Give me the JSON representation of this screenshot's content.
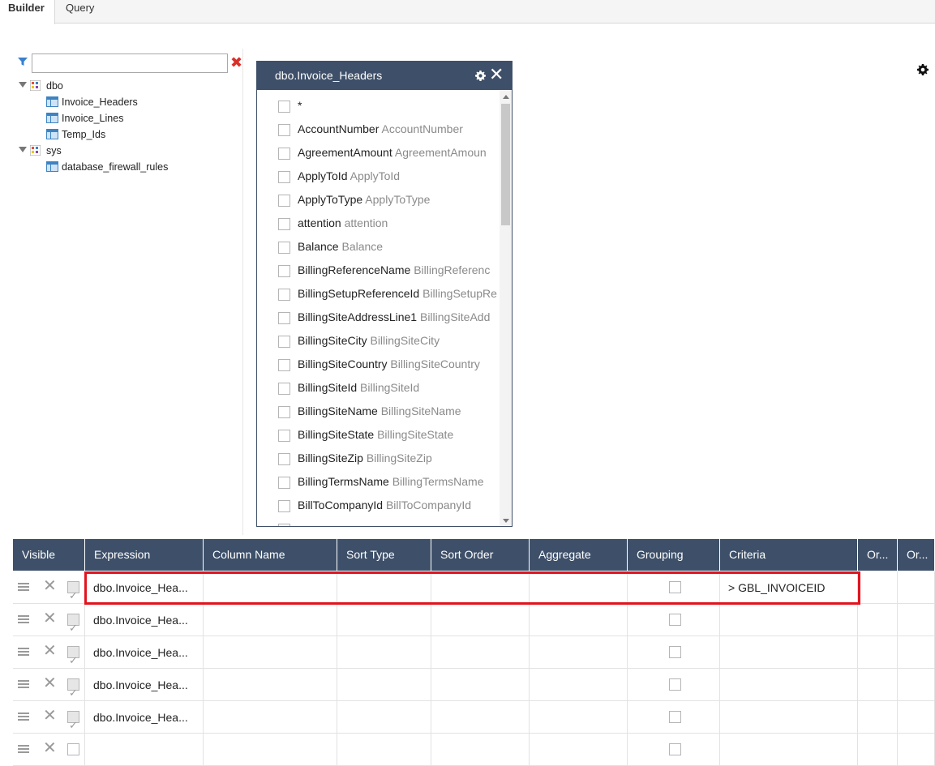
{
  "tabs": [
    {
      "label": "Builder",
      "active": true
    },
    {
      "label": "Query",
      "active": false
    }
  ],
  "tree": {
    "filter_value": "",
    "schemas": [
      {
        "name": "dbo",
        "tables": [
          "Invoice_Headers",
          "Invoice_Lines",
          "Temp_Ids"
        ]
      },
      {
        "name": "sys",
        "tables": [
          "database_firewall_rules"
        ]
      }
    ]
  },
  "entity": {
    "title": "dbo.Invoice_Headers",
    "fields": [
      {
        "name": "*",
        "alias": ""
      },
      {
        "name": "AccountNumber",
        "alias": "AccountNumber"
      },
      {
        "name": "AgreementAmount",
        "alias": "AgreementAmoun"
      },
      {
        "name": "ApplyToId",
        "alias": "ApplyToId"
      },
      {
        "name": "ApplyToType",
        "alias": "ApplyToType"
      },
      {
        "name": "attention",
        "alias": "attention"
      },
      {
        "name": "Balance",
        "alias": "Balance"
      },
      {
        "name": "BillingReferenceName",
        "alias": "BillingReferenc"
      },
      {
        "name": "BillingSetupReferenceId",
        "alias": "BillingSetupRe"
      },
      {
        "name": "BillingSiteAddressLine1",
        "alias": "BillingSiteAdd"
      },
      {
        "name": "BillingSiteCity",
        "alias": "BillingSiteCity"
      },
      {
        "name": "BillingSiteCountry",
        "alias": "BillingSiteCountry"
      },
      {
        "name": "BillingSiteId",
        "alias": "BillingSiteId"
      },
      {
        "name": "BillingSiteName",
        "alias": "BillingSiteName"
      },
      {
        "name": "BillingSiteState",
        "alias": "BillingSiteState"
      },
      {
        "name": "BillingSiteZip",
        "alias": "BillingSiteZip"
      },
      {
        "name": "BillingTermsName",
        "alias": "BillingTermsName"
      },
      {
        "name": "BillToCompanyId",
        "alias": "BillToCompanyId"
      }
    ]
  },
  "grid": {
    "headers": [
      "Visible",
      "Expression",
      "Column Name",
      "Sort Type",
      "Sort Order",
      "Aggregate",
      "Grouping",
      "Criteria",
      "Or...",
      "Or..."
    ],
    "rows": [
      {
        "expression": "dbo.Invoice_Hea...",
        "visible": true,
        "criteria": "> GBL_INVOICEID"
      },
      {
        "expression": "dbo.Invoice_Hea...",
        "visible": true,
        "criteria": ""
      },
      {
        "expression": "dbo.Invoice_Hea...",
        "visible": true,
        "criteria": ""
      },
      {
        "expression": "dbo.Invoice_Hea...",
        "visible": true,
        "criteria": ""
      },
      {
        "expression": "dbo.Invoice_Hea...",
        "visible": true,
        "criteria": ""
      },
      {
        "expression": "",
        "visible": false,
        "criteria": ""
      }
    ]
  },
  "colors": {
    "header_bg": "#3e5069",
    "highlight": "#e1141e",
    "clear_red": "#d9302a"
  }
}
